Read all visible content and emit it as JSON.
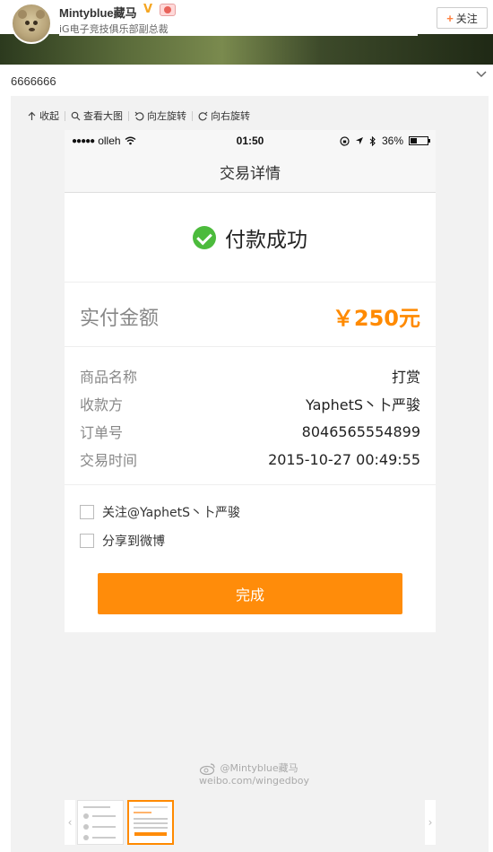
{
  "header": {
    "username": "Mintyblue藏马",
    "verify_mark": "V",
    "description": "iG电子竞技俱乐部副总裁",
    "follow_label": "关注",
    "follow_icon": "+"
  },
  "post": {
    "text": "6666666"
  },
  "viewer": {
    "toolbar": [
      {
        "label": "收起",
        "icon": "collapse-icon"
      },
      {
        "label": "查看大图",
        "icon": "search-icon"
      },
      {
        "label": "向左旋转",
        "icon": "rotate-left-icon"
      },
      {
        "label": "向右旋转",
        "icon": "rotate-right-icon"
      }
    ]
  },
  "phone": {
    "status": {
      "carrier_dots": "●●●●●",
      "carrier": "olleh",
      "time": "01:50",
      "battery": "36%"
    },
    "nav_title": "交易详情",
    "success_text": "付款成功",
    "amount_label": "实付金额",
    "amount_value": "￥250元",
    "details": [
      {
        "key": "商品名称",
        "value": "打赏"
      },
      {
        "key": "收款方",
        "value": "YaphetS丶卜严骏"
      },
      {
        "key": "订单号",
        "value": "8046565554899"
      },
      {
        "key": "交易时间",
        "value": "2015-10-27 00:49:55"
      }
    ],
    "options": [
      {
        "label": "关注@YaphetS丶卜严骏",
        "checked": false
      },
      {
        "label": "分享到微博",
        "checked": false
      }
    ],
    "done_label": "完成"
  },
  "watermark": {
    "line1": "@Mintyblue藏马",
    "line2": "weibo.com/wingedboy"
  },
  "thumbnails": {
    "prev": "‹",
    "next": "›"
  },
  "colors": {
    "accent_orange": "#ff8c0a",
    "success_green": "#4cbb3c"
  }
}
